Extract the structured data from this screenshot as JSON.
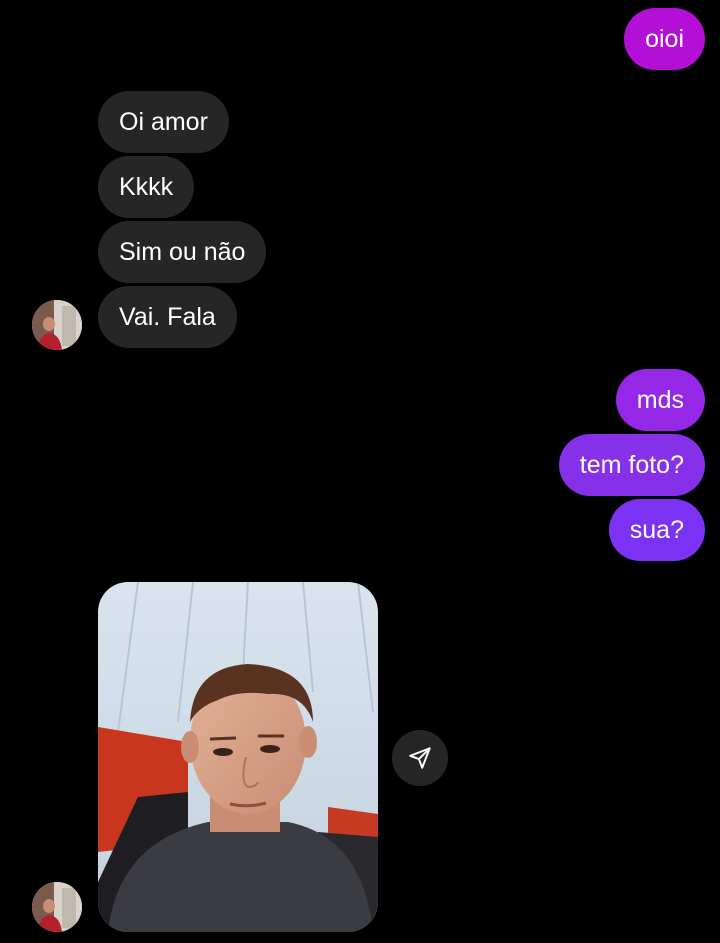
{
  "theme": {
    "background": "#000000",
    "incoming_bubble": "#262626",
    "outgoing_gradient_top": "#b30fd6",
    "outgoing_gradient_bottom": "#7b32f2",
    "text": "#ffffff"
  },
  "conversation": {
    "messages": [
      {
        "direction": "outgoing",
        "text": "oioi"
      },
      {
        "direction": "incoming",
        "text": "Oi amor"
      },
      {
        "direction": "incoming",
        "text": "Kkkk"
      },
      {
        "direction": "incoming",
        "text": "Sim ou não"
      },
      {
        "direction": "incoming",
        "text": "Vai.  Fala"
      },
      {
        "direction": "outgoing",
        "text": "mds"
      },
      {
        "direction": "outgoing",
        "text": "tem foto?"
      },
      {
        "direction": "outgoing",
        "text": "sua?"
      }
    ],
    "photo_message": {
      "direction": "incoming",
      "kind": "selfie-photo",
      "action_icon": "send-icon"
    },
    "sender_avatar_icon": "avatar"
  }
}
